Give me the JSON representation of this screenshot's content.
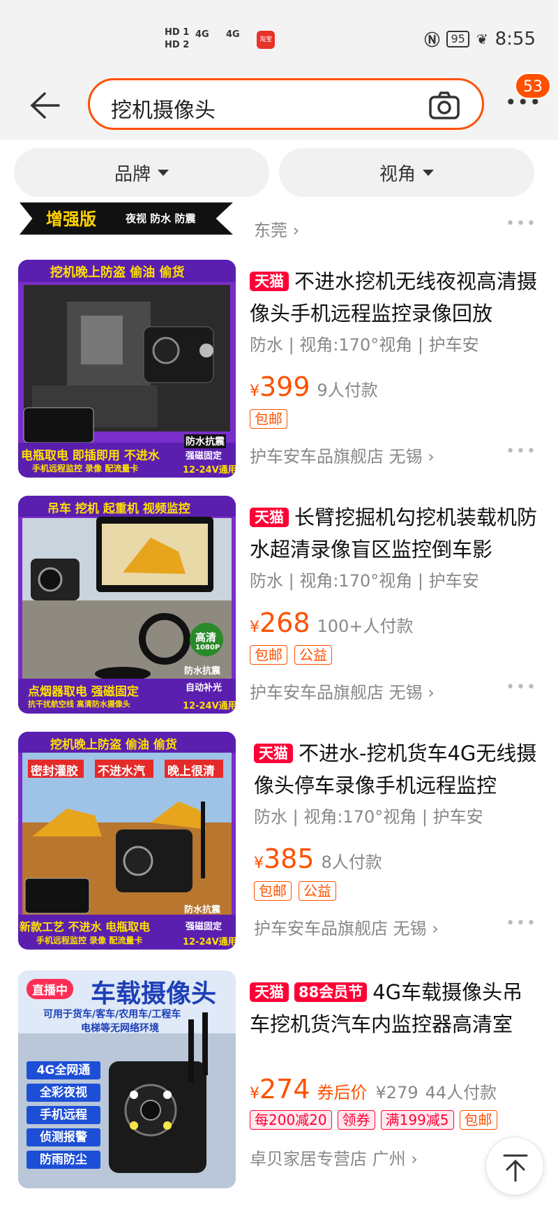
{
  "status_bar": {
    "hd1": "HD 1",
    "hd2": "HD 2",
    "sig1": "4G",
    "sig2": "4G",
    "battery": "95",
    "time": "8:55",
    "app_badge": "淘宝"
  },
  "search": {
    "query": "挖机摄像头",
    "cart_count": "53"
  },
  "filters": [
    {
      "label": "品牌"
    },
    {
      "label": "视角"
    }
  ],
  "prev_item": {
    "banner_main": "增强版",
    "banner_sub": "夜视 防水 防震",
    "store": "东莞 ›"
  },
  "products": [
    {
      "badge": "天猫",
      "title": "不进水挖机无线夜视高清摄像头手机远程监控录像回放",
      "attrs": "防水 | 视角:170°视角 | 护车安",
      "currency": "¥",
      "price": "399",
      "sales": "9人付款",
      "tags": [
        "包邮"
      ],
      "store": "护车安车品旗舰店 无锡 ›",
      "image": {
        "top": "挖机晚上防盗 偷油 偷货",
        "bottom1": "电瓶取电 即插即用 不进水",
        "bottom2": "手机远程监控 录像 配流量卡",
        "side1": "防水抗震",
        "side2": "强磁固定",
        "side3": "12-24V通用"
      }
    },
    {
      "badge": "天猫",
      "title": "长臂挖掘机勾挖机装载机防水超清录像盲区监控倒车影",
      "attrs": "防水 | 视角:170°视角 | 护车安",
      "currency": "¥",
      "price": "268",
      "sales": "100+人付款",
      "tags": [
        "包邮",
        "公益"
      ],
      "store": "护车安车品旗舰店 无锡 ›",
      "image": {
        "top": "吊车 挖机 起重机 视频监控",
        "bottom1": "点烟器取电 强磁固定",
        "bottom2": "抗干扰航空线 高清防水摄像头",
        "hd": "高清",
        "hd2": "1080P",
        "side1": "防水抗震",
        "side2": "自动补光",
        "side3": "12-24V通用"
      }
    },
    {
      "badge": "天猫",
      "title": "不进水-挖机货车4G无线摄像头停车录像手机远程监控",
      "attrs": "防水 | 视角:170°视角 | 护车安",
      "currency": "¥",
      "price": "385",
      "sales": "8人付款",
      "tags": [
        "包邮",
        "公益"
      ],
      "store": "护车安车品旗舰店 无锡 ›",
      "image": {
        "top": "挖机晚上防盗 偷油 偷货",
        "red1": "密封灌胶",
        "red2": "不进水汽",
        "red3": "晚上很清",
        "bottom1": "新款工艺 不进水 电瓶取电",
        "bottom2": "手机远程监控 录像 配流量卡",
        "side1": "防水抗震",
        "side2": "强磁固定",
        "side3": "12-24V通用"
      }
    },
    {
      "badge": "天猫",
      "badge2": "88会员节",
      "title": "4G车载摄像头吊车挖机货汽车内监控器高清室",
      "currency": "¥",
      "price": "274",
      "price_note": "券后价",
      "orig_price": "¥279",
      "sales": "44人付款",
      "tags": [
        "每200减20",
        "领券",
        "满199减5",
        "包邮"
      ],
      "store": "卓贝家居专营店 广州 ›",
      "image": {
        "live": "直播中",
        "title": "车载摄像头",
        "sub1": "可用于货车/客车/农用车/工程车",
        "sub2": "电梯等无网络环境",
        "features": [
          "4G全网通",
          "全彩夜视",
          "手机远程",
          "侦测报警",
          "防雨防尘"
        ]
      }
    }
  ]
}
